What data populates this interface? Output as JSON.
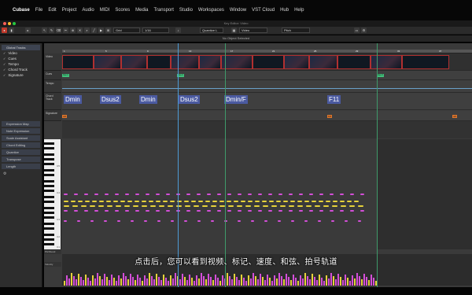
{
  "menubar": {
    "items": [
      "Cubase",
      "File",
      "Edit",
      "Project",
      "Audio",
      "MIDI",
      "Scores",
      "Media",
      "Transport",
      "Studio",
      "Workspaces",
      "Window",
      "VST Cloud",
      "Hub",
      "Help"
    ]
  },
  "titlebar": {
    "title": "Key Editor: Video"
  },
  "toolbar": {
    "grid_label": "Grid",
    "quantize_value": "1/16",
    "quantize_mode": "Quantize L",
    "track_name": "Video",
    "pitch_label": "Pitch"
  },
  "infoline": {
    "text": "No Object Selected"
  },
  "inspector": {
    "header": "Global Tracks",
    "tracks": [
      "Video",
      "Cues",
      "Tempo",
      "Chord Track",
      "Signature"
    ],
    "buttons": [
      "Expression Map",
      "Note Expression",
      "Scale Assistant",
      "Chord Editing",
      "Quantize",
      "Transpose",
      "Length"
    ]
  },
  "editor": {
    "lane_labels": [
      "Video",
      "Cues",
      "Tempo",
      "Chord Track",
      "Signature"
    ],
    "ruler_marks": [
      "1",
      "5",
      "9",
      "13",
      "17",
      "21",
      "25",
      "29",
      "33",
      "37"
    ],
    "cue_markers": [
      "Cue 1",
      "Cue 2",
      "Cue 3"
    ],
    "chords": [
      "Dmin",
      "Dsus2",
      "Dmin",
      "Dsus2",
      "Dmin/F",
      "F11"
    ],
    "signatures": [
      "4/4",
      "6/4",
      "4/4"
    ],
    "key_labels": [
      "C5",
      "C4",
      "C3",
      "C2",
      "C1"
    ],
    "controller_labels": [
      "Pitchbend",
      "Velocity"
    ]
  },
  "subtitle": "点击后，您可以看到视频、标记、速度、和弦、拍号轨道",
  "colors": {
    "chord_block": "#4b5aa0",
    "signature": "#e0772c",
    "cue_marker": "#41c07a",
    "note_pink": "#d44fd8",
    "note_yellow": "#e6d23a",
    "playhead": "#4d9bd6"
  }
}
